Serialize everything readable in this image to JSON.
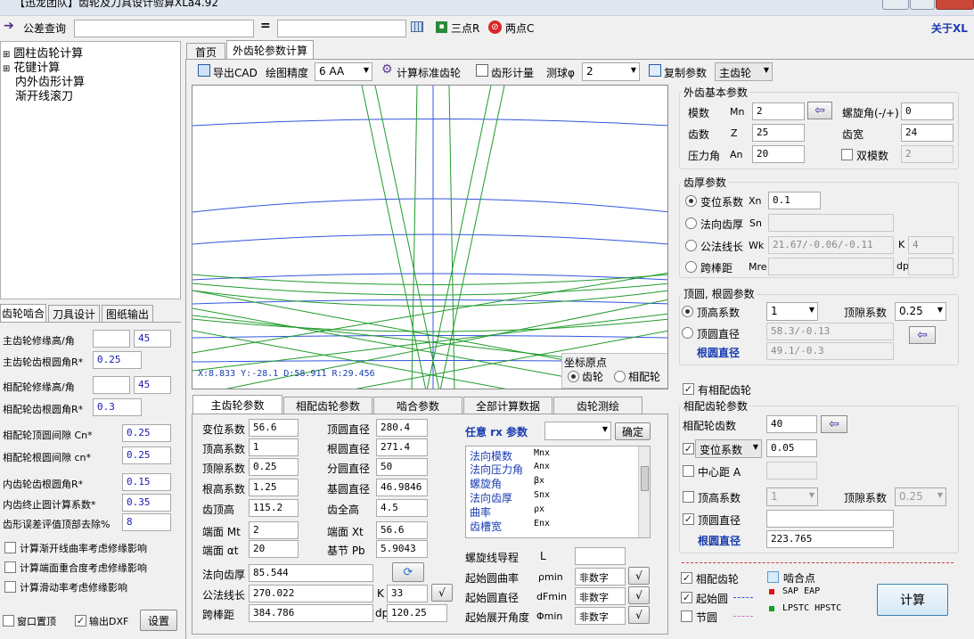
{
  "window": {
    "title": "【迅龙团队】齿轮及刀具设计验算XLa4.92"
  },
  "toolbar": {
    "tolerance_label": "公差查询",
    "equals": "=",
    "three_point": "三点R",
    "two_point": "两点C",
    "about": "关于XL"
  },
  "tree": {
    "items": [
      "圆柱齿轮计算",
      "花键计算",
      "内外齿形计算",
      "渐开线滚刀"
    ]
  },
  "left_tabs": [
    "齿轮啮合",
    "刀具设计",
    "图纸输出"
  ],
  "left_params": [
    {
      "label": "主齿轮修缘高/角",
      "v1": "",
      "v2": "45"
    },
    {
      "label": "主齿轮齿根圆角R*",
      "v1": "0.25"
    },
    {
      "label": "相配轮修缘高/角",
      "v1": "",
      "v2": "45"
    },
    {
      "label": "相配轮齿根圆角R*",
      "v1": "0.3"
    },
    {
      "label": "相配轮顶圆间隙  Cn*",
      "v2": "0.25"
    },
    {
      "label": "相配轮根圆间隙  cn*",
      "v2": "0.25"
    },
    {
      "label": "内齿轮齿根圆角R*",
      "v2": "0.15"
    },
    {
      "label": "内齿终止圆计算系数*",
      "v2": "0.35"
    },
    {
      "label": "齿形误差评值顶部去除%",
      "v2": "8"
    }
  ],
  "left_checks": [
    "计算渐开线曲率考虑修缘影响",
    "计算端面重合度考虑修缘影响",
    "计算滑动率考虑修缘影响"
  ],
  "left_bottom": {
    "topmost": "窗口置顶",
    "dxf": "输出DXF",
    "settings": "设置"
  },
  "main_tabs": [
    "首页",
    "外齿轮参数计算"
  ],
  "main_toolbar": {
    "export_cad": "导出CAD",
    "precision_label": "绘图精度",
    "precision_value": "6  AA",
    "calc_std": "计算标准齿轮",
    "tooth_measure": "齿形计量",
    "ball_label": "测球φ",
    "ball_value": "2",
    "copy_params": "复制参数",
    "gear_select": "主齿轮"
  },
  "plot": {
    "status": "X:8.833   Y:-28.1   D:58.911   R:29.456",
    "origin_title": "坐标原点",
    "origin_gear": "齿轮",
    "origin_mate": "相配轮"
  },
  "bottom_tabs": [
    "主齿轮参数",
    "相配齿轮参数",
    "啮合参数",
    "全部计算数据",
    "齿轮测绘"
  ],
  "main_params_left": [
    {
      "label": "变位系数",
      "value": "56.6"
    },
    {
      "label": "顶高系数",
      "value": "1"
    },
    {
      "label": "顶隙系数",
      "value": "0.25"
    },
    {
      "label": "根高系数",
      "value": "1.25"
    },
    {
      "label": "齿顶高",
      "value": "115.2"
    },
    {
      "label": "端面 Mt",
      "value": "2"
    },
    {
      "label": "端面 αt",
      "value": "20"
    }
  ],
  "main_params_mid": [
    {
      "label": "顶圆直径",
      "value": "280.4"
    },
    {
      "label": "根圆直径",
      "value": "271.4"
    },
    {
      "label": "分圆直径",
      "value": "50"
    },
    {
      "label": "基圆直径",
      "value": "46.9846"
    },
    {
      "label": "齿全高",
      "value": "4.5"
    },
    {
      "label": "端面 Xt",
      "value": "56.6"
    },
    {
      "label": "基节 Pb",
      "value": "5.9043"
    }
  ],
  "thickness_rows": [
    {
      "label": "法向齿厚",
      "value": "85.544"
    },
    {
      "label": "公法线长",
      "value": "270.022",
      "k_label": "K",
      "k": "33"
    },
    {
      "label": "跨棒距",
      "value": "384.786",
      "dp_label": "dp",
      "dp": "120.25"
    }
  ],
  "rx": {
    "title": "任意 rx 参数",
    "confirm": "确定",
    "list": [
      {
        "name": "法向模数",
        "sym": "Mnx"
      },
      {
        "name": "法向压力角",
        "sym": "Anx"
      },
      {
        "name": "螺旋角",
        "sym": "βx"
      },
      {
        "name": "法向齿厚",
        "sym": "Snx"
      },
      {
        "name": "曲率",
        "sym": "ρx"
      },
      {
        "name": "齿槽宽",
        "sym": "Enx"
      }
    ]
  },
  "helix_lead": {
    "label": "螺旋线导程",
    "sym": "L",
    "value": ""
  },
  "start_rows": [
    {
      "label": "起始圆曲率",
      "sym": "ρmin",
      "value": "非数字"
    },
    {
      "label": "起始圆直径",
      "sym": "dFmin",
      "value": "非数字"
    },
    {
      "label": "起始展开角度",
      "sym": "Φmin",
      "value": "非数字"
    }
  ],
  "ext_basic": {
    "title": "外齿基本参数",
    "module_label": "模数",
    "module_sym": "Mn",
    "module": "2",
    "helix_label": "螺旋角(-/+)",
    "helix": "0",
    "teeth_label": "齿数",
    "teeth_sym": "Z",
    "teeth": "25",
    "width_label": "齿宽",
    "width": "24",
    "pa_label": "压力角",
    "pa_sym": "An",
    "pa": "20",
    "dual_label": "双模数",
    "dual": "2"
  },
  "thickness": {
    "title": "齿厚参数",
    "shift_label": "变位系数",
    "shift_sym": "Xn",
    "shift": "0.1",
    "normal_label": "法向齿厚",
    "normal_sym": "Sn",
    "wk_label": "公法线长",
    "wk_sym": "Wk",
    "wk": "21.67/-0.06/-0.11",
    "k_label": "K",
    "k": "4",
    "mre_label": "跨棒距",
    "mre_sym": "Mre",
    "dp_label": "dp"
  },
  "tip_root": {
    "title": "顶圆, 根圆参数",
    "addendum_label": "顶高系数",
    "addendum": "1",
    "clearance_label": "顶隙系数",
    "clearance": "0.25",
    "tip_label": "顶圆直径",
    "tip": "58.3/-0.13",
    "root_label": "根圆直径",
    "root": "49.1/-0.3"
  },
  "mate": {
    "has_mate": "有相配齿轮",
    "title": "相配齿轮参数",
    "teeth_label": "相配轮齿数",
    "teeth": "40",
    "shift_select": "变位系数",
    "shift": "0.05",
    "center_label": "中心距 A",
    "addendum_label": "顶高系数",
    "addendum": "1",
    "clearance_label": "顶隙系数",
    "clearance": "0.25",
    "tip_label": "顶圆直径",
    "tip": "",
    "root_label": "根圆直径",
    "root": "223.765"
  },
  "legend": {
    "mate_gear": "相配齿轮",
    "start_circle": "起始圆",
    "pitch_circle": "节圆",
    "mesh_point": "啮合点",
    "sap": "SAP EAP",
    "lpstc": "LPSTC HPSTC",
    "calc": "计算"
  },
  "colors": {
    "plot_blue": "#3355dd",
    "plot_green": "#1f9b2a",
    "accent": "#1a3cb0"
  }
}
